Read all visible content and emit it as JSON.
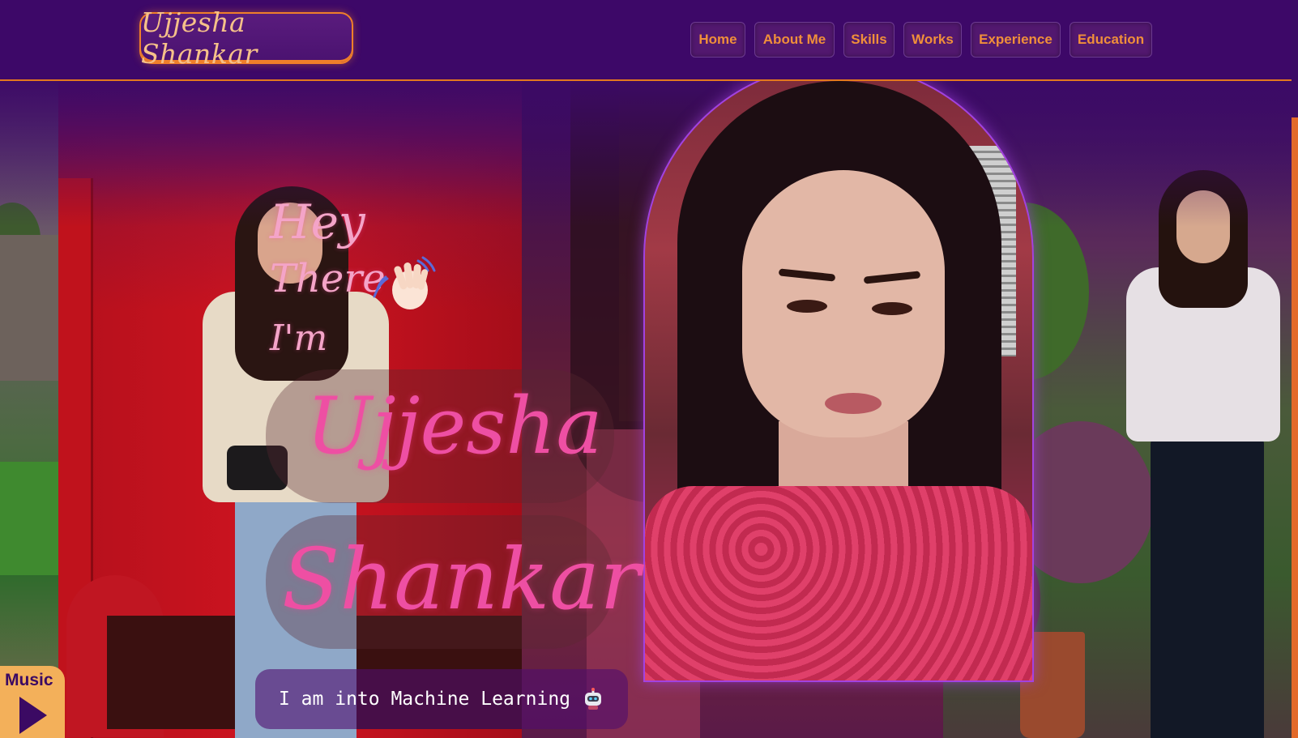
{
  "header": {
    "logo_text": "Ujjesha Shankar",
    "nav": [
      {
        "label": "Home"
      },
      {
        "label": "About Me"
      },
      {
        "label": "Skills"
      },
      {
        "label": "Works"
      },
      {
        "label": "Experience"
      },
      {
        "label": "Education"
      }
    ]
  },
  "hero": {
    "greeting": [
      "Hey",
      "There",
      "I'm"
    ],
    "first_name": "Ujjesha",
    "last_name": "Shankar",
    "tagline": "I am into Machine Learning",
    "wave_icon": "waving-hand-icon",
    "tagline_icon": "robot-icon"
  },
  "music": {
    "label": "Music",
    "icon": "play-icon"
  },
  "colors": {
    "header_bg": "#3d0868",
    "accent_orange": "#f08f3a",
    "name_pink": "#ee4fa3",
    "greeting_pink": "#f4a4c8",
    "portrait_border": "#a242e0"
  }
}
